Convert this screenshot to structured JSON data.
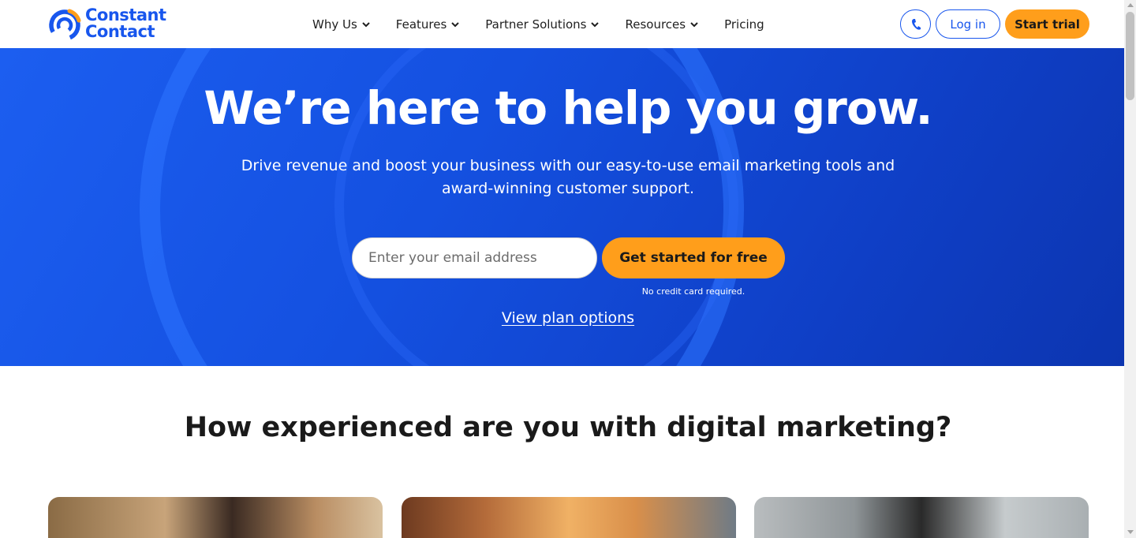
{
  "brand": {
    "name_line1": "Constant",
    "name_line2": "Contact",
    "colors": {
      "primary": "#1856ed",
      "accent": "#ff9e1b"
    }
  },
  "nav": {
    "items": [
      {
        "label": "Why Us",
        "has_dropdown": true
      },
      {
        "label": "Features",
        "has_dropdown": true
      },
      {
        "label": "Partner Solutions",
        "has_dropdown": true
      },
      {
        "label": "Resources",
        "has_dropdown": true
      },
      {
        "label": "Pricing",
        "has_dropdown": false
      }
    ],
    "phone_icon": "phone-icon",
    "login_label": "Log in",
    "trial_label": "Start trial"
  },
  "hero": {
    "title": "We’re here to help you grow.",
    "subtitle": "Drive revenue and boost your business with our easy-to-use email marketing tools and award-winning customer support.",
    "email_placeholder": "Enter your email address",
    "cta_label": "Get started for free",
    "no_credit_card": "No credit card required.",
    "view_plans": "View plan options"
  },
  "experience": {
    "title": "How experienced are you with digital marketing?"
  }
}
